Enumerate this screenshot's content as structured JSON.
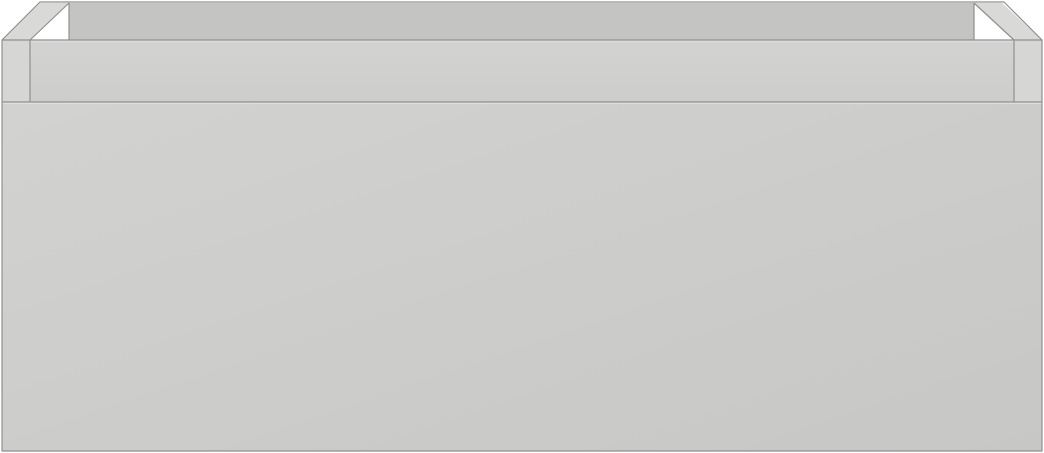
{
  "object": {
    "kind": "drawer-unit",
    "colors": {
      "front": "#cdcdcb",
      "front_shade": "#c6c6c4",
      "rim": "#d0d0ce",
      "inner_back": "#c4c4c2",
      "inner_side": "#d9d9d7",
      "side_panel": "#d6d6d4",
      "outline": "#8f8f8f",
      "edge_light": "#e6e6e4",
      "background": "#ffffff"
    }
  }
}
